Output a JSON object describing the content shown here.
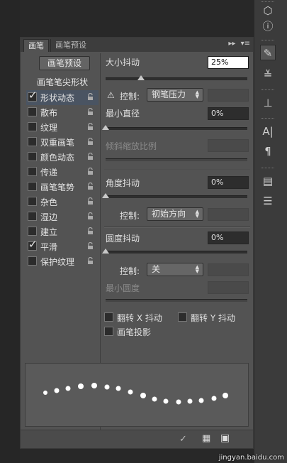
{
  "tabs": [
    "画笔",
    "画笔预设"
  ],
  "panel_menu_icons": [
    "double-arrow-icon",
    "menu-icon"
  ],
  "preset_button": "画笔预设",
  "list_header": "画笔笔尖形状",
  "list_items": [
    {
      "label": "形状动态",
      "checked": true,
      "selected": true
    },
    {
      "label": "散布",
      "checked": false,
      "selected": false
    },
    {
      "label": "纹理",
      "checked": false,
      "selected": false
    },
    {
      "label": "双重画笔",
      "checked": false,
      "selected": false
    },
    {
      "label": "颜色动态",
      "checked": false,
      "selected": false
    },
    {
      "label": "传递",
      "checked": false,
      "selected": false
    },
    {
      "label": "画笔笔势",
      "checked": false,
      "selected": false
    },
    {
      "label": "杂色",
      "checked": false,
      "selected": false
    },
    {
      "label": "湿边",
      "checked": false,
      "selected": false
    },
    {
      "label": "建立",
      "checked": false,
      "selected": false
    },
    {
      "label": "平滑",
      "checked": true,
      "selected": false
    },
    {
      "label": "保护纹理",
      "checked": false,
      "selected": false
    }
  ],
  "size_jitter": {
    "label": "大小抖动",
    "value": "25%",
    "level": 0.25
  },
  "control1": {
    "label": "控制:",
    "value": "钢笔压力"
  },
  "min_diameter": {
    "label": "最小直径",
    "value": "0%",
    "level": 0
  },
  "tilt_scale": {
    "label": "倾斜缩放比例"
  },
  "angle_jitter": {
    "label": "角度抖动",
    "value": "0%",
    "level": 0
  },
  "control2": {
    "label": "控制:",
    "value": "初始方向"
  },
  "roundness_jitter": {
    "label": "圆度抖动",
    "value": "0%",
    "level": 0
  },
  "control3": {
    "label": "控制:",
    "value": "关"
  },
  "min_roundness": {
    "label": "最小圆度"
  },
  "flip_x": {
    "label": "翻转 X 抖动",
    "checked": false
  },
  "flip_y": {
    "label": "翻转 Y 抖动",
    "checked": false
  },
  "brush_projection": {
    "label": "画笔投影",
    "checked": false
  },
  "watermark": "jingyan.baidu.com",
  "right_tools": [
    "cube-icon",
    "info-icon",
    "brush-icon",
    "adjust-icon",
    "stamp-icon",
    "text-icon",
    "paragraph-icon",
    "book-icon",
    "document-icon"
  ]
}
